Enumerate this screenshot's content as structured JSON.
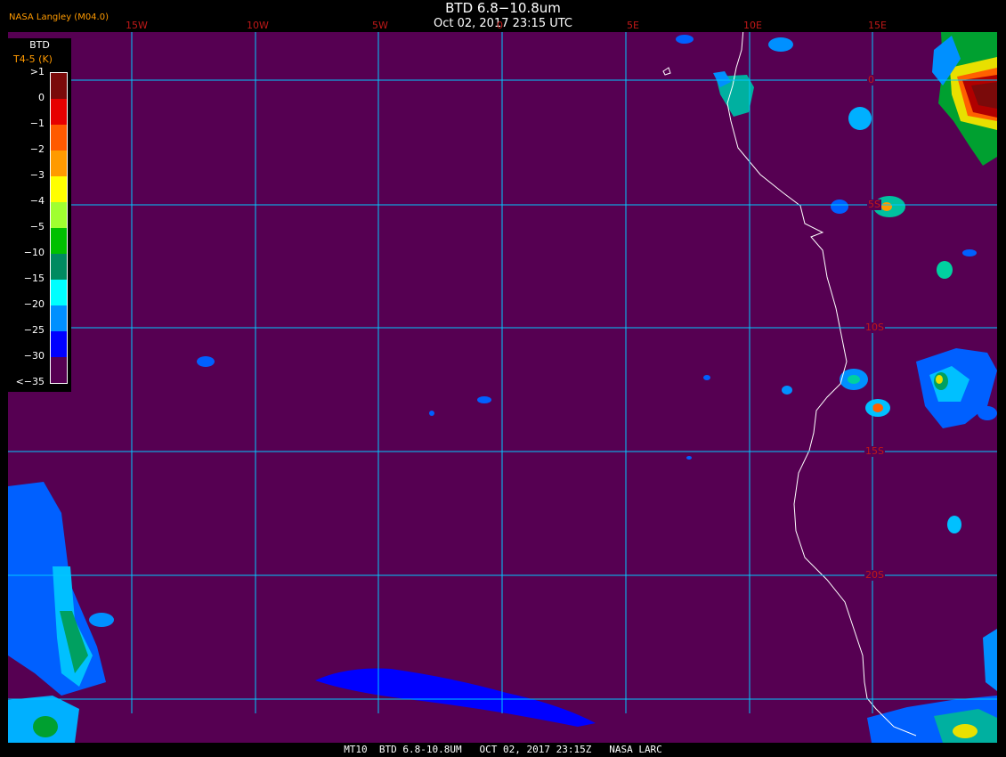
{
  "header": {
    "title": "BTD 6.8−10.8um",
    "subtitle": "Oct 02, 2017 23:15 UTC",
    "source": "NASA Langley (M04.0)"
  },
  "footer": {
    "text": "MT10  BTD 6.8-10.8UM   OCT 02, 2017 23:15Z   NASA LARC"
  },
  "legend": {
    "title": "BTD",
    "unit": "T4-5 (K)",
    "ticks": [
      ">1",
      "0",
      "−1",
      "−2",
      "−3",
      "−4",
      "−5",
      "−10",
      "−15",
      "−20",
      "−25",
      "−30",
      "<−35"
    ],
    "colors": [
      "#7a0a0a",
      "#e60000",
      "#ff5a00",
      "#ff9a00",
      "#ffff00",
      "#a0ff30",
      "#00c000",
      "#008a60",
      "#00ffff",
      "#0090ff",
      "#0000ff",
      "#560052"
    ]
  },
  "map": {
    "background_color": "#560052",
    "grid_color": "#00c8ff",
    "coast_color": "#ffffff",
    "label_color": "#c01818",
    "longitude_labels": [
      "15W",
      "10W",
      "5W",
      "0",
      "5E",
      "10E",
      "15E"
    ],
    "latitude_labels": [
      "0",
      "5S",
      "10S",
      "15S",
      "20S"
    ]
  }
}
